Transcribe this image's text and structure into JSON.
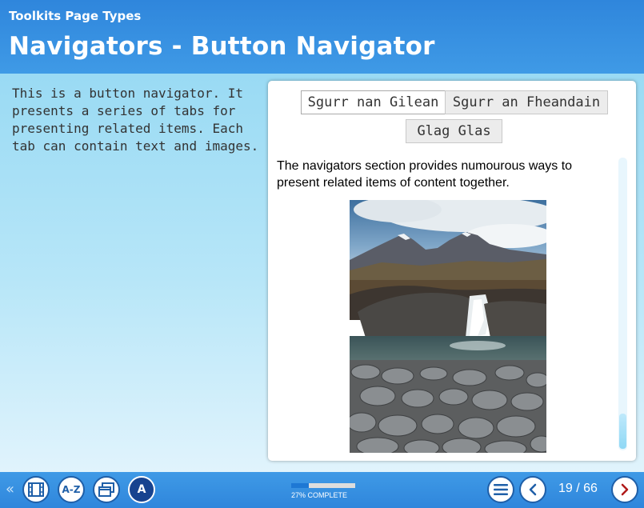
{
  "header": {
    "course_title": "Toolkits Page Types",
    "page_title": "Navigators - Button Navigator"
  },
  "intro": {
    "text": "This is a button navigator. It presents a series of tabs for presenting related items. Each tab can contain text and images."
  },
  "navigator": {
    "tabs": [
      {
        "label": "Sgurr nan Gilean",
        "active": true
      },
      {
        "label": "Sgurr an Fheandain",
        "active": false
      },
      {
        "label": "Glag Glas",
        "active": false
      }
    ],
    "content_text": "The navigators section provides numourous ways to present related items of content together.",
    "image_icon": "mountain-waterfall-photo"
  },
  "footer": {
    "collapse_icon": "double-chevron-left-icon",
    "buttons": [
      {
        "icon": "film-icon"
      },
      {
        "label": "A-Z"
      },
      {
        "icon": "windows-icon"
      },
      {
        "label": "A"
      }
    ],
    "progress": {
      "percent": 27,
      "label": "27% COMPLETE"
    },
    "menu_icon": "hamburger-menu-icon",
    "page_count": "19 / 66",
    "colors": {
      "accent": "#2f86dc",
      "navy": "#17438f",
      "next_arrow": "#b01a1a"
    }
  }
}
